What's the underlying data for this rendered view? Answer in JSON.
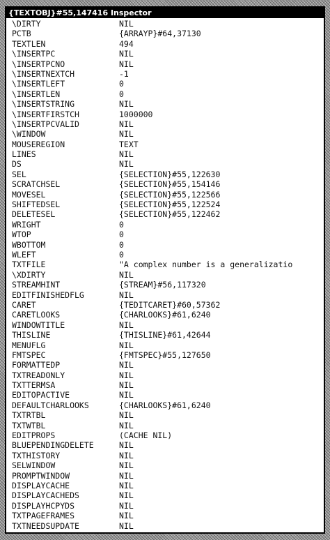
{
  "window": {
    "title": "{TEXTOBJ}#55,147416 Inspector"
  },
  "rows": [
    {
      "prop": "\\DIRTY",
      "value": "NIL"
    },
    {
      "prop": "PCTB",
      "value": "{ARRAYP}#64,37130"
    },
    {
      "prop": "TEXTLEN",
      "value": "494"
    },
    {
      "prop": "\\INSERTPC",
      "value": "NIL"
    },
    {
      "prop": "\\INSERTPCNO",
      "value": "NIL"
    },
    {
      "prop": "\\INSERTNEXTCH",
      "value": "-1"
    },
    {
      "prop": "\\INSERTLEFT",
      "value": "0"
    },
    {
      "prop": "\\INSERTLEN",
      "value": "0"
    },
    {
      "prop": "\\INSERTSTRING",
      "value": "NIL"
    },
    {
      "prop": "\\INSERTFIRSTCH",
      "value": "1000000"
    },
    {
      "prop": "\\INSERTPCVALID",
      "value": "NIL"
    },
    {
      "prop": "\\WINDOW",
      "value": "NIL"
    },
    {
      "prop": "MOUSEREGION",
      "value": "TEXT"
    },
    {
      "prop": "LINES",
      "value": "NIL"
    },
    {
      "prop": "DS",
      "value": "NIL"
    },
    {
      "prop": "SEL",
      "value": "{SELECTION}#55,122630"
    },
    {
      "prop": "SCRATCHSEL",
      "value": "{SELECTION}#55,154146"
    },
    {
      "prop": "MOVESEL",
      "value": "{SELECTION}#55,122566"
    },
    {
      "prop": "SHIFTEDSEL",
      "value": "{SELECTION}#55,122524"
    },
    {
      "prop": "DELETESEL",
      "value": "{SELECTION}#55,122462"
    },
    {
      "prop": "WRIGHT",
      "value": "0"
    },
    {
      "prop": "WTOP",
      "value": "0"
    },
    {
      "prop": "WBOTTOM",
      "value": "0"
    },
    {
      "prop": "WLEFT",
      "value": "0"
    },
    {
      "prop": "TXTFILE",
      "value": "\"A complex number is a generalizatio"
    },
    {
      "prop": "\\XDIRTY",
      "value": "NIL"
    },
    {
      "prop": "STREAMHINT",
      "value": "{STREAM}#56,117320"
    },
    {
      "prop": "EDITFINISHEDFLG",
      "value": "NIL"
    },
    {
      "prop": "CARET",
      "value": "{TEDITCARET}#60,57362"
    },
    {
      "prop": "CARETLOOKS",
      "value": "{CHARLOOKS}#61,6240"
    },
    {
      "prop": "WINDOWTITLE",
      "value": "NIL"
    },
    {
      "prop": "THISLINE",
      "value": "{THISLINE}#61,42644"
    },
    {
      "prop": "MENUFLG",
      "value": "NIL"
    },
    {
      "prop": "FMTSPEC",
      "value": "{FMTSPEC}#55,127650"
    },
    {
      "prop": "FORMATTEDP",
      "value": "NIL"
    },
    {
      "prop": "TXTREADONLY",
      "value": "NIL"
    },
    {
      "prop": "TXTTERMSA",
      "value": "NIL"
    },
    {
      "prop": "EDITOPACTIVE",
      "value": "NIL"
    },
    {
      "prop": "DEFAULTCHARLOOKS",
      "value": "{CHARLOOKS}#61,6240"
    },
    {
      "prop": "TXTRTBL",
      "value": "NIL"
    },
    {
      "prop": "TXTWTBL",
      "value": "NIL"
    },
    {
      "prop": "EDITPROPS",
      "value": "(CACHE NIL)"
    },
    {
      "prop": "BLUEPENDINGDELETE",
      "value": "NIL"
    },
    {
      "prop": "TXTHISTORY",
      "value": "NIL"
    },
    {
      "prop": "SELWINDOW",
      "value": "NIL"
    },
    {
      "prop": "PROMPTWINDOW",
      "value": "NIL"
    },
    {
      "prop": "DISPLAYCACHE",
      "value": "NIL"
    },
    {
      "prop": "DISPLAYCACHEDS",
      "value": "NIL"
    },
    {
      "prop": "DISPLAYHCPYDS",
      "value": "NIL"
    },
    {
      "prop": "TXTPAGEFRAMES",
      "value": "NIL"
    },
    {
      "prop": "TXTNEEDSUPDATE",
      "value": "NIL"
    }
  ]
}
